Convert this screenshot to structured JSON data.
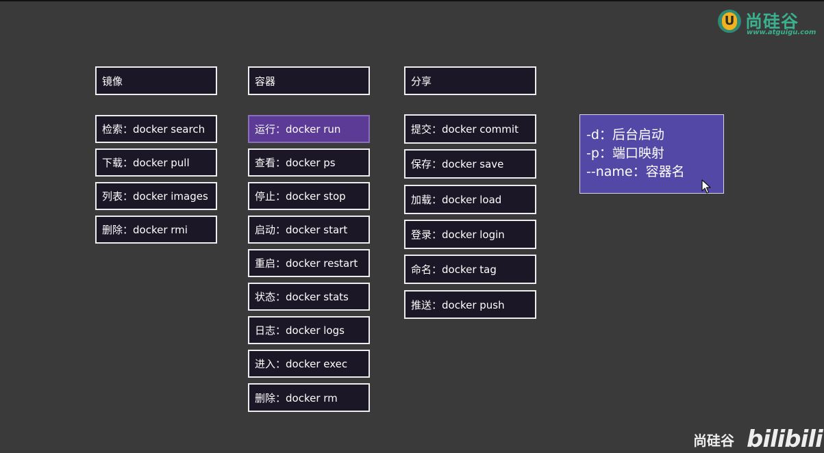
{
  "logo": {
    "name": "尚硅谷",
    "mark": "U",
    "url": "www.atguigu.com"
  },
  "columns": {
    "image": {
      "header": "镜像",
      "items": [
        "检索：docker search",
        "下载：docker pull",
        "列表：docker images",
        "删除：docker rmi"
      ]
    },
    "container": {
      "header": "容器",
      "items": [
        "运行：docker run",
        "查看：docker ps",
        "停止：docker stop",
        "启动：docker start",
        "重启：docker restart",
        "状态：docker stats",
        "日志：docker logs",
        "进入：docker exec",
        "删除：docker rm"
      ]
    },
    "share": {
      "header": "分享",
      "items": [
        "提交：docker commit",
        "保存：docker save",
        "加载：docker load",
        "登录：docker login",
        "命名：docker tag",
        "推送：docker push"
      ]
    }
  },
  "info": {
    "lines": [
      "-d：后台启动",
      "-p：端口映射",
      "--name：容器名"
    ]
  },
  "watermark": {
    "text": "尚硅谷",
    "brand": "bilibili"
  },
  "colors": {
    "background": "#3a3a3a",
    "box": "#1b1726",
    "active": "#5b3b96",
    "info": "#5448a6",
    "logo": "#3bb08f"
  }
}
